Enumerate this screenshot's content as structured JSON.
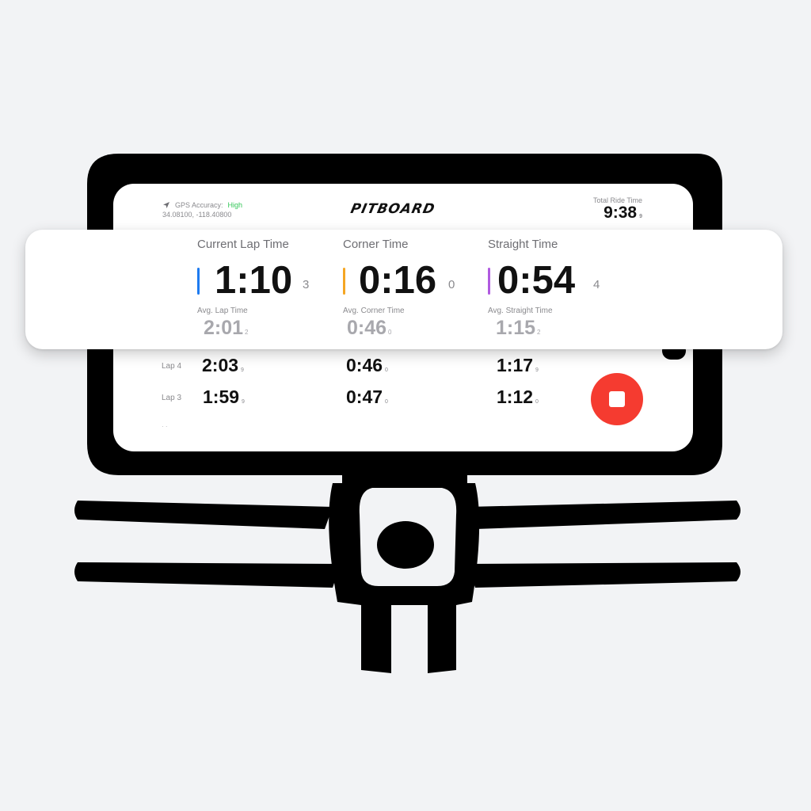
{
  "colors": {
    "accent_lap": "#1e7bf0",
    "accent_corner": "#f5a623",
    "accent_straight": "#b05ae0",
    "gps_good": "#34c759",
    "stop": "#f53b30"
  },
  "header": {
    "gps_label": "GPS Accuracy:",
    "gps_value": "High",
    "coords": "34.08100, -118.40800",
    "logo": "PITBOARD",
    "ride_label": "Total Ride Time",
    "ride_value": "9:38",
    "ride_sub": "9"
  },
  "metrics": [
    {
      "title": "Current Lap Time",
      "value": "1:10",
      "count": "3",
      "avg_label": "Avg. Lap Time",
      "avg_value": "2:01",
      "avg_sub": "2"
    },
    {
      "title": "Corner Time",
      "value": "0:16",
      "count": "0",
      "avg_label": "Avg. Corner Time",
      "avg_value": "0:46",
      "avg_sub": "0"
    },
    {
      "title": "Straight Time",
      "value": "0:54",
      "count": "4",
      "avg_label": "Avg. Straight Time",
      "avg_value": "1:15",
      "avg_sub": "2"
    }
  ],
  "laps": [
    {
      "label": "Lap 4",
      "lap": "2:03",
      "lap_sub": "9",
      "corner": "0:46",
      "corner_sub": "0",
      "straight": "1:17",
      "straight_sub": "9"
    },
    {
      "label": "Lap 3",
      "lap": "1:59",
      "lap_sub": "9",
      "corner": "0:47",
      "corner_sub": "0",
      "straight": "1:12",
      "straight_sub": "0"
    }
  ],
  "icons": {
    "gps": "location-arrow-icon",
    "stop": "stop-icon"
  }
}
